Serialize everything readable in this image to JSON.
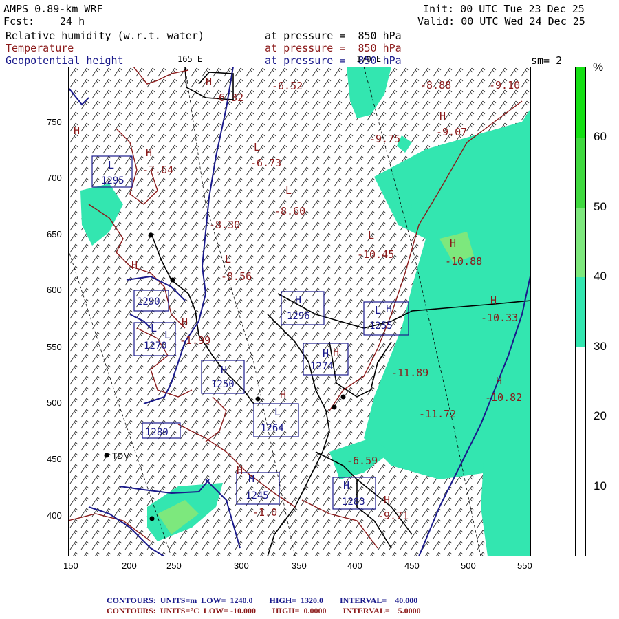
{
  "header": {
    "model": "AMPS 0.89-km WRF",
    "fcst_label": "Fcst:",
    "fcst_value": "24 h",
    "init": "Init: 00 UTC Tue 23 Dec 25",
    "valid": "Valid: 00 UTC Wed 24 Dec 25"
  },
  "fields": [
    {
      "name": "Relative humidity (w.r.t. water)",
      "level": "at pressure =  850 hPa",
      "color": "#000000"
    },
    {
      "name": "Temperature",
      "level": "at pressure =  850 hPa",
      "color": "#8b1a1a"
    },
    {
      "name": "Geopotential height",
      "level": "at pressure =  850 hPa",
      "color": "#1a1a8b"
    }
  ],
  "meridians": {
    "left": "165 E",
    "right": "170 E"
  },
  "smoothing": "sm= 2",
  "colorbar": {
    "unit": "%",
    "ticks": [
      "10",
      "20",
      "30",
      "40",
      "50",
      "60"
    ],
    "levels": [
      {
        "from": 0,
        "to": 30,
        "color": "#ffffff"
      },
      {
        "from": 30,
        "to": 40,
        "color": "#33e6b0"
      },
      {
        "from": 40,
        "to": 50,
        "color": "#7de87d"
      },
      {
        "from": 50,
        "to": 60,
        "color": "#3fd93f"
      },
      {
        "from": 60,
        "to": 70,
        "color": "#14e014"
      }
    ]
  },
  "axes": {
    "x_ticks": [
      "150",
      "200",
      "250",
      "300",
      "350",
      "400",
      "450",
      "500",
      "550"
    ],
    "y_ticks": [
      "400",
      "450",
      "500",
      "550",
      "600",
      "650",
      "700",
      "750"
    ]
  },
  "stations": [
    {
      "name": "TDM"
    }
  ],
  "height_labels": [
    "1295",
    "1290",
    "1270",
    "1280",
    "1250",
    "1264",
    "1245",
    "1274",
    "1283",
    "1296",
    "1255"
  ],
  "temp_labels": [
    "-8.88",
    "-9.10",
    "-6.52",
    "-9.07",
    "-6.73",
    "-8.60",
    "-8.30",
    "-8.56",
    "-10.45",
    "-10.88",
    "-10.33",
    "-11.89",
    "-10.82",
    "-11.72",
    "-9.75",
    "-7.64",
    "-1.99",
    "-9.71",
    "-6.32",
    "-1.0",
    "-6.59"
  ],
  "footer": {
    "line1": "CONTOURS:  UNITS=m  LOW=  1240.0        HIGH=  1320.0        INTERVAL=    40.000",
    "line2": "CONTOURS:  UNITS=°C  LOW= -10.000        HIGH=  0.0000        INTERVAL=    5.0000"
  }
}
